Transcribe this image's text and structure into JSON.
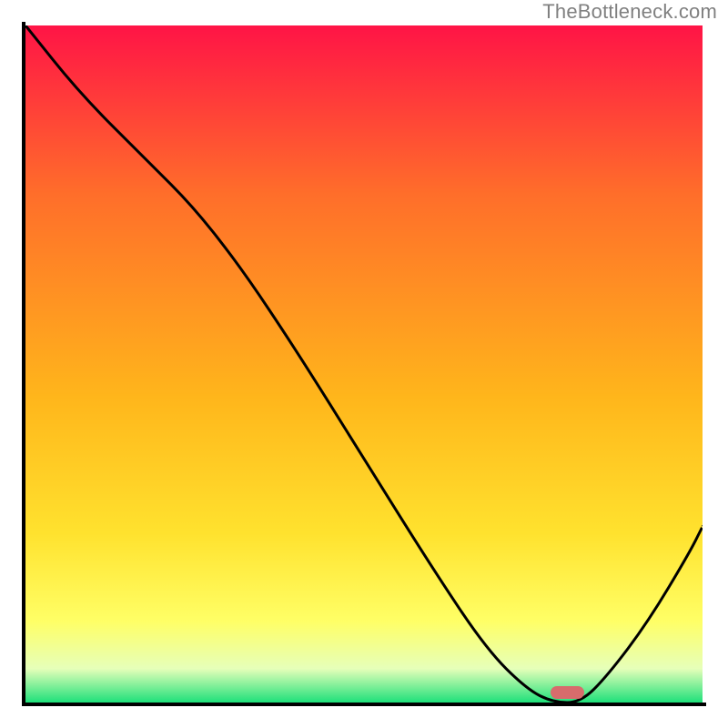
{
  "watermark": "TheBottleneck.com",
  "colors": {
    "top": "#ff1446",
    "g25": "#ff6e2a",
    "g55": "#ffb61b",
    "g75": "#ffe22e",
    "g88": "#ffff66",
    "g95": "#e6ffb9",
    "bottom": "#1ee07a",
    "curve": "#000000",
    "marker": "#d76c6c",
    "axis": "#000000"
  },
  "chart_data": {
    "type": "line",
    "title": "",
    "xlabel": "",
    "ylabel": "",
    "xlim": [
      0,
      100
    ],
    "ylim": [
      0,
      100
    ],
    "series": [
      {
        "name": "curve",
        "x": [
          0,
          8,
          18,
          25,
          32,
          40,
          50,
          60,
          68,
          74,
          78,
          82,
          86,
          92,
          98,
          100
        ],
        "values": [
          100,
          90,
          80,
          73,
          64,
          52,
          36,
          20,
          8,
          2,
          0,
          0,
          4,
          12,
          22,
          26
        ]
      }
    ],
    "marker": {
      "x_center": 80,
      "y": 1.5,
      "width_pct": 5,
      "height_pct": 1.8
    }
  }
}
